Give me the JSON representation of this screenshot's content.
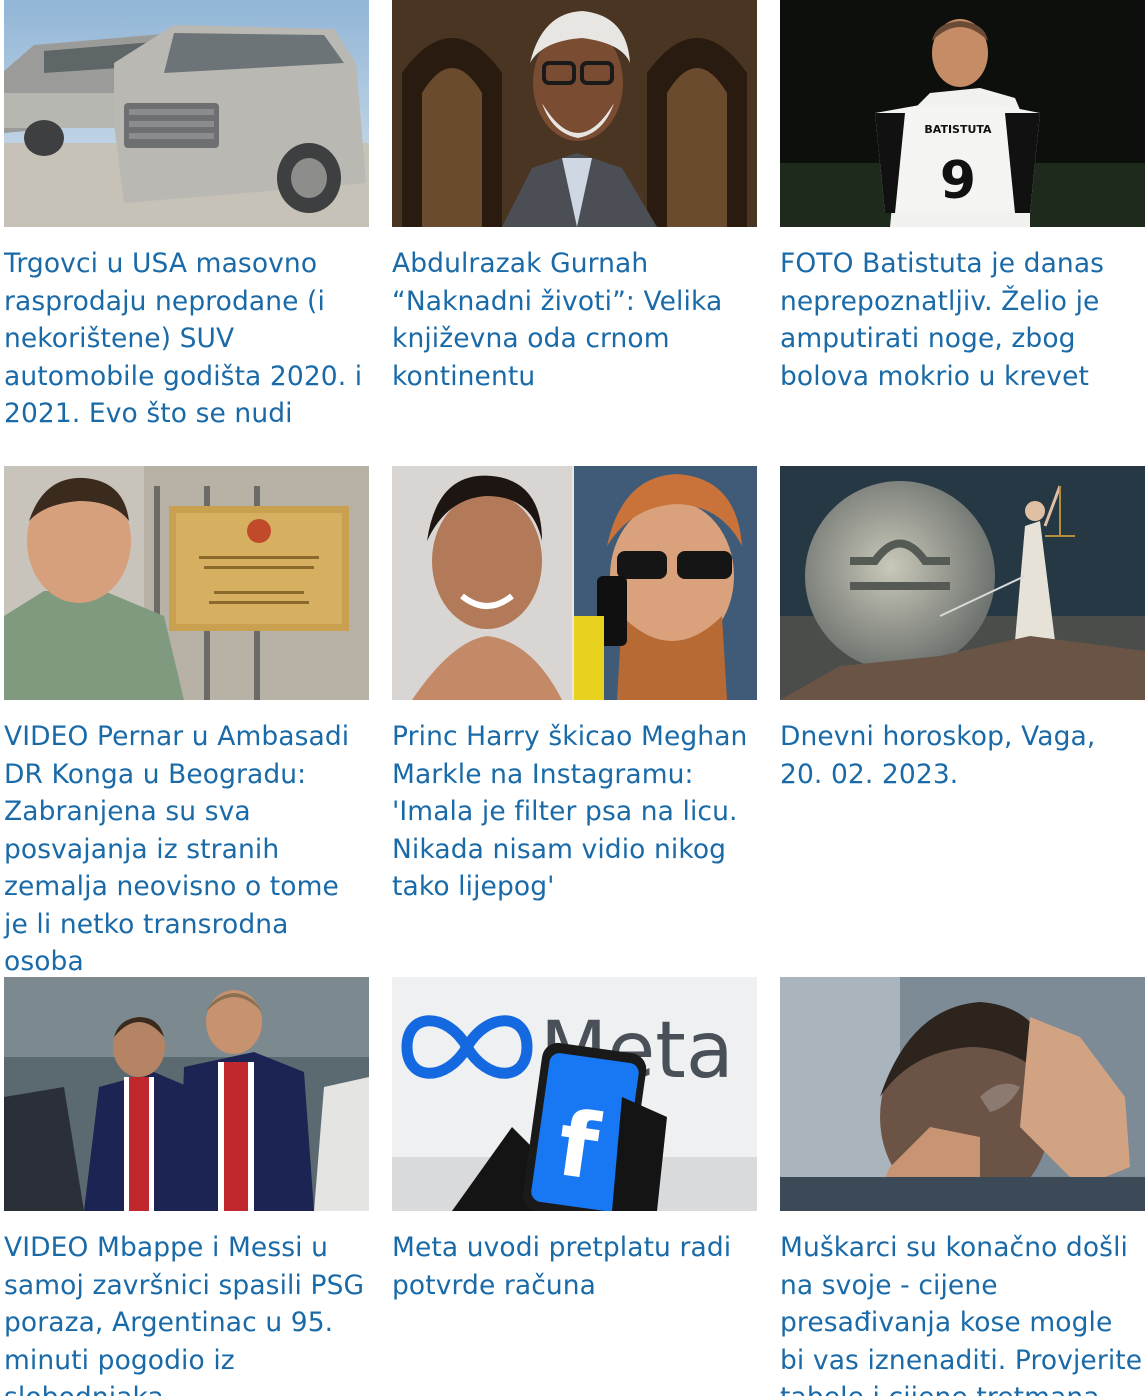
{
  "articles": [
    {
      "title": "Trgovci u USA masovno rasprodaju neprodane (i nekorištene) SUV automobile godišta 2020. i 2021. Evo što se nudi",
      "image": "dusty-suv-cars-photo"
    },
    {
      "title": "Abdulrazak Gurnah “Naknadni životi”: Velika književna oda crnom kontinentu",
      "image": "author-portrait-photo"
    },
    {
      "title": "FOTO Batistuta je danas neprepoznatljiv. Želio je amputirati noge, zbog bolova mokrio u krevet",
      "image": "man-holding-jersey-photo",
      "jersey_name": "BATISTUTA",
      "jersey_number": "9"
    },
    {
      "title": "VIDEO Pernar u Ambasadi DR Konga u Beogradu: Zabranjena su sva posvajanja iz stranih zemalja neovisno o tome je li netko transrodna osoba",
      "image": "man-at-embassy-plaque-photo"
    },
    {
      "title": "Princ Harry škicao Meghan Markle na Instagramu: 'Imala je filter psa na licu. Nikada nisam vidio nikog tako lijepog'",
      "image": "harry-meghan-photo"
    },
    {
      "title": "Dnevni horoskop, Vaga, 20. 02. 2023.",
      "image": "libra-moon-illustration"
    },
    {
      "title": "VIDEO Mbappe i Messi u samoj završnici spasili PSG poraza, Argentinac u 95. minuti pogodio iz slobodnjaka",
      "image": "psg-players-photo"
    },
    {
      "title": "Meta uvodi pretplatu radi potvrde računa",
      "image": "meta-facebook-phone-photo",
      "logo_text": "Meta"
    },
    {
      "title": "Muškarci su konačno došli na svoje - cijene presađivanja kose mogle bi vas iznenaditi. Provjerite tabele i cijene tretmana",
      "image": "hair-loss-man-photo"
    }
  ],
  "colors": {
    "link": "#1a6aa8",
    "background": "#ffffff"
  }
}
